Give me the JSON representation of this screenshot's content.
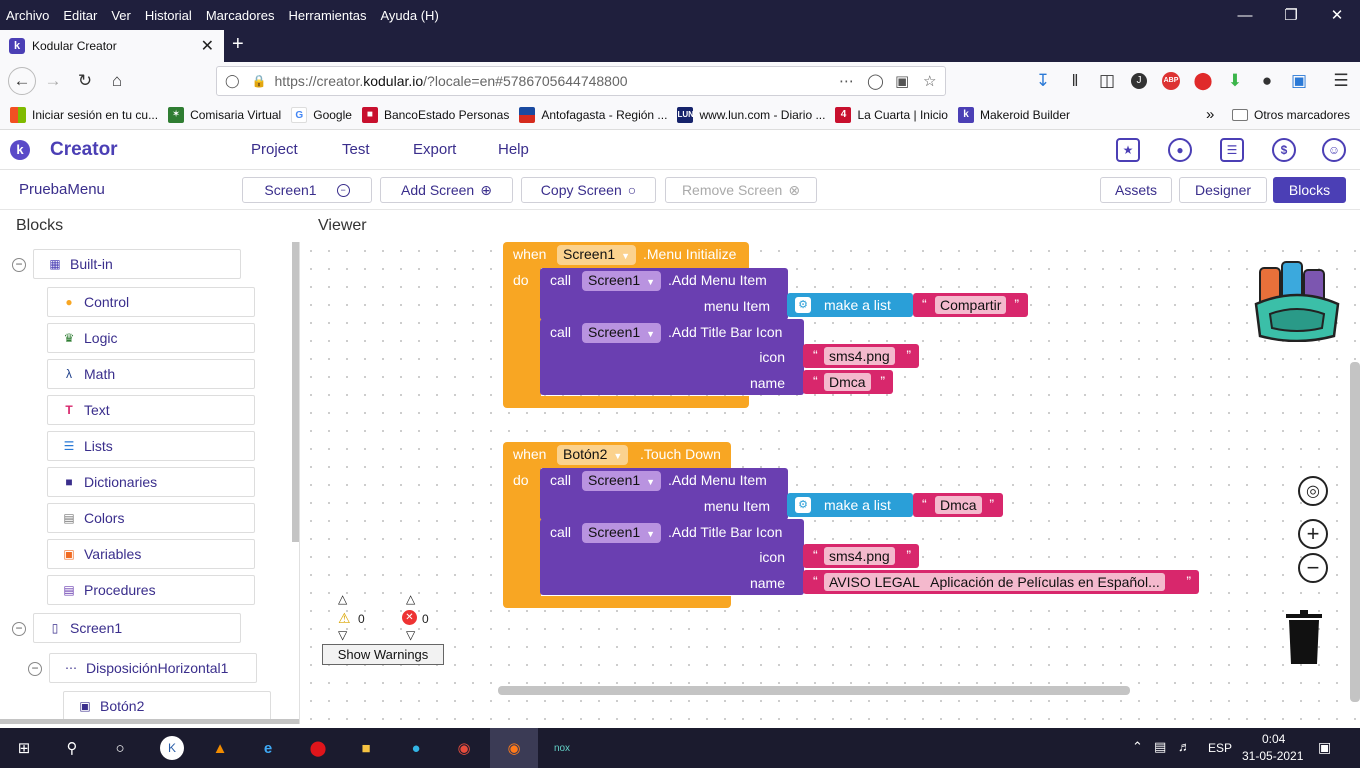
{
  "browser": {
    "menu": [
      "Archivo",
      "Editar",
      "Ver",
      "Historial",
      "Marcadores",
      "Herramientas",
      "Ayuda (H)"
    ],
    "tab_title": "Kodular Creator",
    "url_prefix": "https://creator.",
    "url_domain": "kodular.io",
    "url_rest": "/?locale=en#5786705644748800",
    "bookmarks": [
      "Iniciar sesión en tu cu...",
      "Comisaria Virtual",
      "Google",
      "BancoEstado Personas",
      "Antofagasta - Región ...",
      "www.lun.com - Diario ...",
      "La Cuarta | Inicio",
      "Makeroid Builder"
    ],
    "other_bookmarks": "Otros marcadores"
  },
  "app": {
    "brand": "Creator",
    "menu": [
      "Project",
      "Test",
      "Export",
      "Help"
    ],
    "project_name": "PruebaMenu",
    "screen_select": "Screen1",
    "add_screen": "Add Screen",
    "copy_screen": "Copy Screen",
    "remove_screen": "Remove Screen",
    "view_buttons": [
      "Assets",
      "Designer",
      "Blocks"
    ]
  },
  "blocks_panel": {
    "title": "Blocks",
    "builtin": "Built-in",
    "categories": [
      "Control",
      "Logic",
      "Math",
      "Text",
      "Lists",
      "Dictionaries",
      "Colors",
      "Variables",
      "Procedures"
    ],
    "screen": "Screen1",
    "arrangement": "DisposiciónHorizontal1",
    "button": "Botón2"
  },
  "viewer": {
    "title": "Viewer",
    "event1": {
      "when": "when",
      "component": "Screen1",
      "event": ".Menu Initialize",
      "do": "do",
      "call1": {
        "call": "call",
        "component": "Screen1",
        "method": ".Add Menu Item",
        "param": "menu Item",
        "list": "make a list",
        "value": "Compartir"
      },
      "call2": {
        "call": "call",
        "component": "Screen1",
        "method": ".Add Title Bar Icon",
        "param_icon": "icon",
        "icon_value": "sms4.png",
        "param_name": "name",
        "name_value": "Dmca"
      }
    },
    "event2": {
      "when": "when",
      "component": "Botón2",
      "event": ".Touch Down",
      "do": "do",
      "call1": {
        "call": "call",
        "component": "Screen1",
        "method": ".Add Menu Item",
        "param": "menu Item",
        "list": "make a list",
        "value": "Dmca"
      },
      "call2": {
        "call": "call",
        "component": "Screen1",
        "method": ".Add Title Bar Icon",
        "param_icon": "icon",
        "icon_value": "sms4.png",
        "param_name": "name",
        "name_value": "AVISO LEGAL   Aplicación de Películas en Español..."
      }
    },
    "warnings_count": "0",
    "errors_count": "0",
    "show_warnings": "Show Warnings"
  },
  "taskbar": {
    "lang": "ESP",
    "time": "0:04",
    "date": "31-05-2021"
  }
}
